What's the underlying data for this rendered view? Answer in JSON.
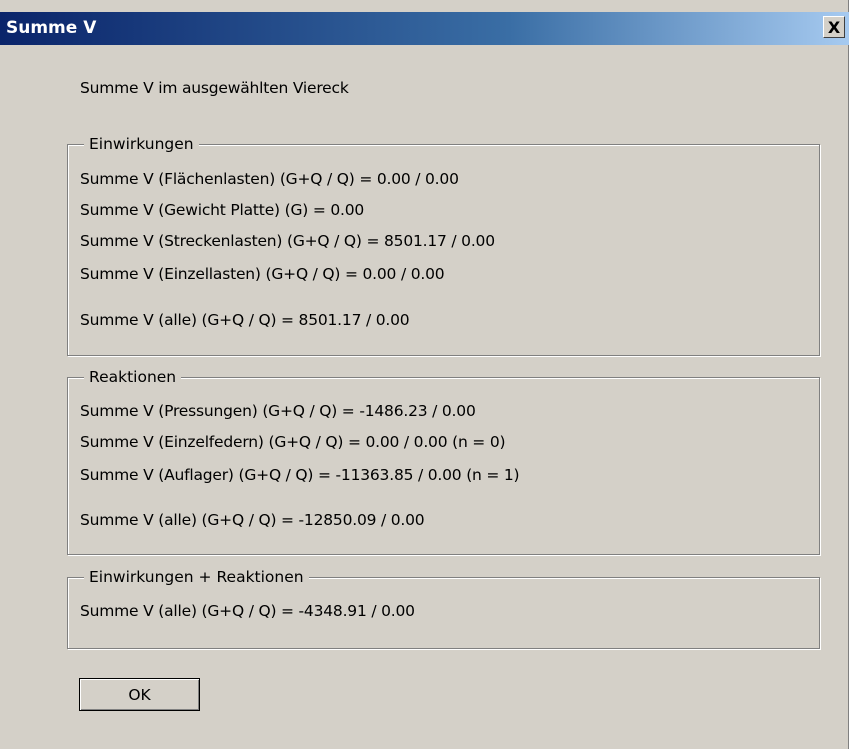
{
  "window": {
    "title": "Summe V",
    "close_label": "X"
  },
  "intro": "Summe V im ausgewählten Viereck",
  "einwirkungen": {
    "caption": "Einwirkungen",
    "lines": [
      "Summe V (Flächenlasten) (G+Q / Q) = 0.00 / 0.00",
      "Summe V (Gewicht Platte) (G) = 0.00",
      "Summe V (Streckenlasten) (G+Q / Q) = 8501.17 / 0.00",
      "Summe V (Einzellasten) (G+Q / Q) = 0.00 / 0.00"
    ],
    "total": "Summe V (alle) (G+Q / Q) = 8501.17 / 0.00"
  },
  "reaktionen": {
    "caption": "Reaktionen",
    "lines": [
      "Summe V (Pressungen) (G+Q / Q) = -1486.23 / 0.00",
      "Summe V (Einzelfedern) (G+Q / Q) = 0.00 / 0.00 (n = 0)",
      "Summe V (Auflager) (G+Q / Q) = -11363.85 / 0.00 (n = 1)"
    ],
    "total": "Summe V (alle) (G+Q / Q) = -12850.09 / 0.00"
  },
  "kombiniert": {
    "caption": "Einwirkungen + Reaktionen",
    "total": "Summe V (alle) (G+Q / Q) = -4348.91 / 0.00"
  },
  "buttons": {
    "ok": "OK"
  }
}
